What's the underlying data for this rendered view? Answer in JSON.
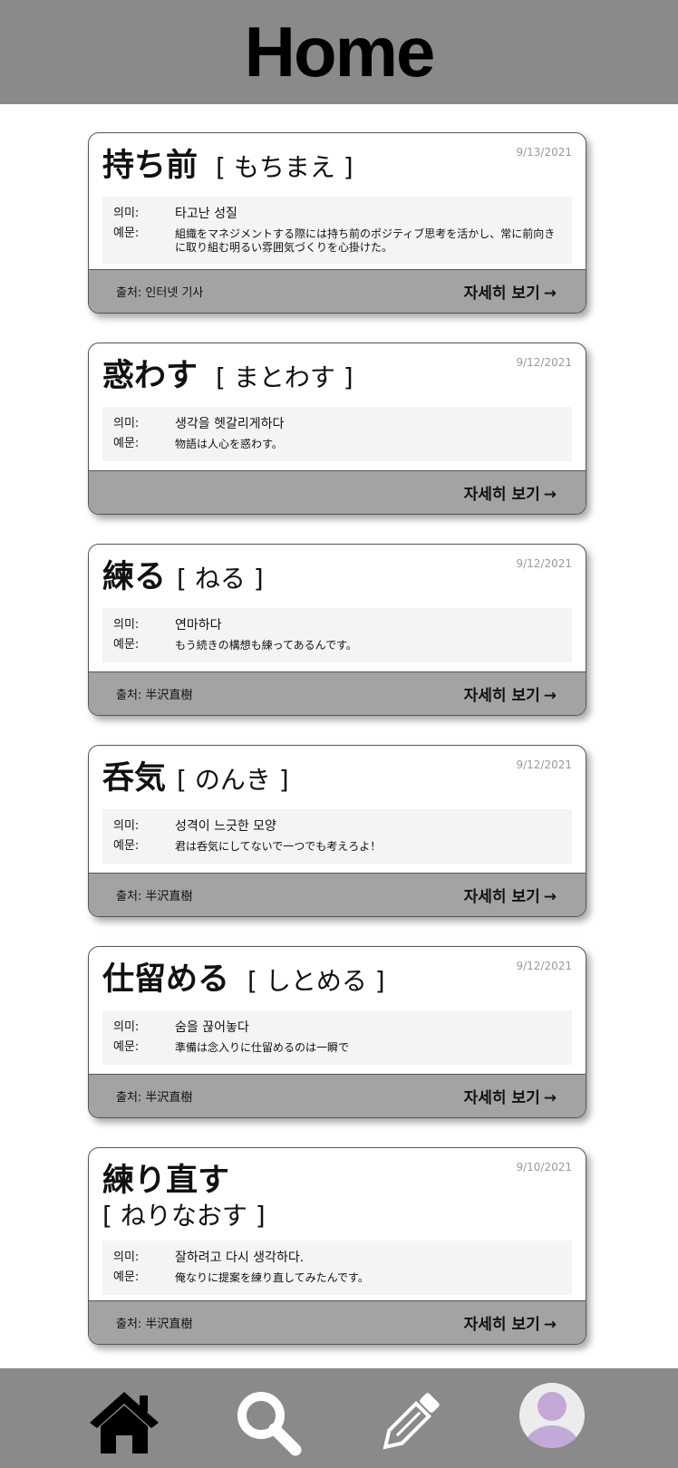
{
  "header": {
    "title": "Home"
  },
  "cards": [
    {
      "word": "持ち前",
      "reading": "[ もちまえ ]",
      "date": "9/13/2021",
      "meaning_label": "의미:",
      "meaning": "타고난 성질",
      "example_label": "예문:",
      "example": "組織をマネジメントする際には持ち前のポジティブ思考を活かし、常に前向きに取り組む明るい雰囲気づくりを心掛けた。",
      "source": "출처: 인터넷 기사",
      "more": "자세히 보기"
    },
    {
      "word": "惑わす",
      "reading": "[ まとわす ]",
      "date": "9/12/2021",
      "meaning_label": "의미:",
      "meaning": "생각을 헷갈리게하다",
      "example_label": "예문:",
      "example": "物語は人心を惑わす。",
      "source": "",
      "more": "자세히 보기"
    },
    {
      "word": "練る",
      "reading": "[ ねる ]",
      "date": "9/12/2021",
      "meaning_label": "의미:",
      "meaning": "연마하다",
      "example_label": "예문:",
      "example": "もう続きの構想も練ってあるんです。",
      "source": "출처: 半沢直樹",
      "more": "자세히 보기"
    },
    {
      "word": "呑気",
      "reading": "[ のんき ]",
      "date": "9/12/2021",
      "meaning_label": "의미:",
      "meaning": "성격이 느긋한 모양",
      "example_label": "예문:",
      "example": "君は呑気にしてないで一つでも考えろよ！",
      "source": "출처: 半沢直樹",
      "more": "자세히 보기"
    },
    {
      "word": "仕留める",
      "reading": "[ しとめる ]",
      "date": "9/12/2021",
      "meaning_label": "의미:",
      "meaning": "숨을 끊어놓다",
      "example_label": "예문:",
      "example": "準備は念入りに仕留めるのは一瞬で",
      "source": "출처: 半沢直樹",
      "more": "자세히 보기"
    },
    {
      "word": "練り直す",
      "reading": "[ ねりなおす ]",
      "date": "9/10/2021",
      "meaning_label": "의미:",
      "meaning": "잘하려고 다시 생각하다.",
      "example_label": "예문:",
      "example": "俺なりに提案を練り直してみたんです。",
      "source": "출처: 半沢直樹",
      "more": "자세히 보기"
    }
  ],
  "more_arrow": "→",
  "tabbar": {
    "items": [
      "home-icon",
      "search-icon",
      "pencil-icon",
      "profile-icon"
    ],
    "colors": {
      "bar": "#8a8a8a",
      "icon_dark": "#000000",
      "icon_light": "#ffffff",
      "avatar_bg": "#ececec",
      "avatar_fg": "#c3a9d8"
    }
  }
}
